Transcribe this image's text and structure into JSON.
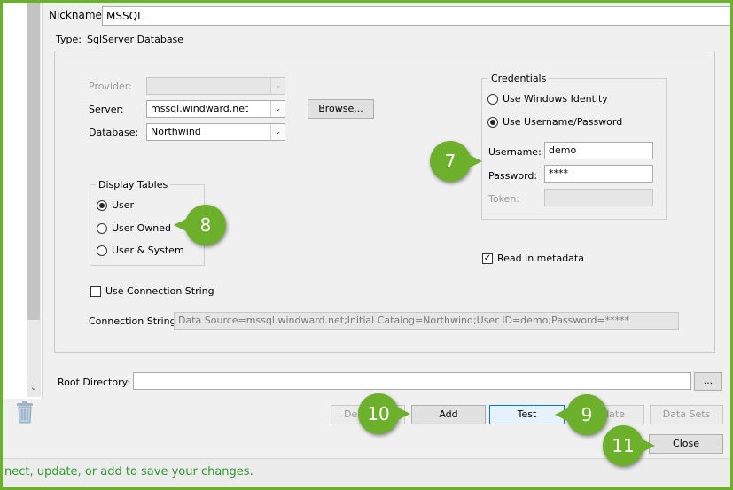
{
  "form": {
    "nickname_label": "Nickname:",
    "nickname_value": "MSSQL",
    "type_label": "Type:",
    "type_value": "SqlServer Database"
  },
  "connection": {
    "provider_label": "Provider:",
    "provider_value": "",
    "server_label": "Server:",
    "server_value": "mssql.windward.net",
    "database_label": "Database:",
    "database_value": "Northwind",
    "browse_label": "Browse..."
  },
  "display_tables": {
    "legend": "Display Tables",
    "options": [
      {
        "label": "User",
        "selected": true
      },
      {
        "label": "User Owned",
        "selected": false
      },
      {
        "label": "User & System",
        "selected": false
      }
    ]
  },
  "credentials": {
    "legend": "Credentials",
    "windows_identity_label": "Use Windows Identity",
    "windows_identity_selected": false,
    "username_password_label": "Use Username/Password",
    "username_password_selected": true,
    "username_label": "Username:",
    "username_value": "demo",
    "password_label": "Password:",
    "password_value": "****",
    "token_label": "Token:",
    "token_value": ""
  },
  "read_metadata": {
    "label": "Read in metadata",
    "checked": true
  },
  "use_connection_string": {
    "label": "Use Connection String",
    "checked": false
  },
  "connection_string": {
    "label": "Connection String:",
    "value": "Data Source=mssql.windward.net;Initial Catalog=Northwind;User ID=demo;Password=*****"
  },
  "root_directory": {
    "label": "Root Directory:",
    "value": "",
    "browse_label": "..."
  },
  "buttons": {
    "delete_partial": "De",
    "add": "Add",
    "test": "Test",
    "update_partial": "date",
    "data_sets": "Data Sets",
    "close": "Close"
  },
  "callouts": {
    "c7": "7",
    "c8": "8",
    "c9": "9",
    "c10": "10",
    "c11": "11"
  },
  "status": {
    "text": "nect, update, or add to save your changes."
  },
  "colors": {
    "callout": "#6cb02b",
    "status_text": "#2f9a2f",
    "focus_border": "#0078d7"
  },
  "icons": {
    "scroll_down": "chevron-down-icon",
    "delete": "trash-icon"
  }
}
